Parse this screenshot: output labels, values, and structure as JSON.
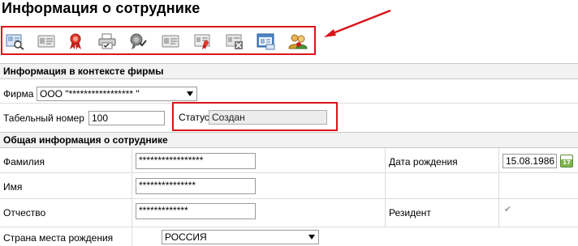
{
  "page": {
    "title": "Информация о сотруднике"
  },
  "toolbar": {
    "buttons": [
      {
        "name": "search-card-icon"
      },
      {
        "name": "id-card-icon"
      },
      {
        "name": "award-ribbon-icon"
      },
      {
        "name": "printer-icon"
      },
      {
        "name": "medal-gray-icon"
      },
      {
        "name": "id-card-icon"
      },
      {
        "name": "card-red-icon"
      },
      {
        "name": "card-delete-icon"
      },
      {
        "name": "window-card-icon"
      },
      {
        "name": "users-icon"
      }
    ]
  },
  "company_section": {
    "header": "Информация в контексте фирмы",
    "firm_label": "Фирма",
    "firm_value": "ООО \"***************** \"",
    "tab_number_label": "Табельный номер",
    "tab_number_value": "100",
    "status_label": "Статус",
    "status_value": "Создан"
  },
  "general_section": {
    "header": "Общая информация о сотруднике",
    "last_name_label": "Фамилия",
    "last_name_value": "*****************",
    "first_name_label": "Имя",
    "first_name_value": "***************",
    "middle_name_label": "Отчество",
    "middle_name_value": "*************",
    "birth_date_label": "Дата рождения",
    "birth_date_value": "15.08.1986",
    "calendar_day": "17",
    "resident_label": "Резидент",
    "resident_checked": true,
    "birth_country_label": "Страна места рождения",
    "birth_country_value": "РОССИЯ"
  },
  "colors": {
    "highlight": "#d9141b",
    "section_bg": "#f2f2f2"
  }
}
